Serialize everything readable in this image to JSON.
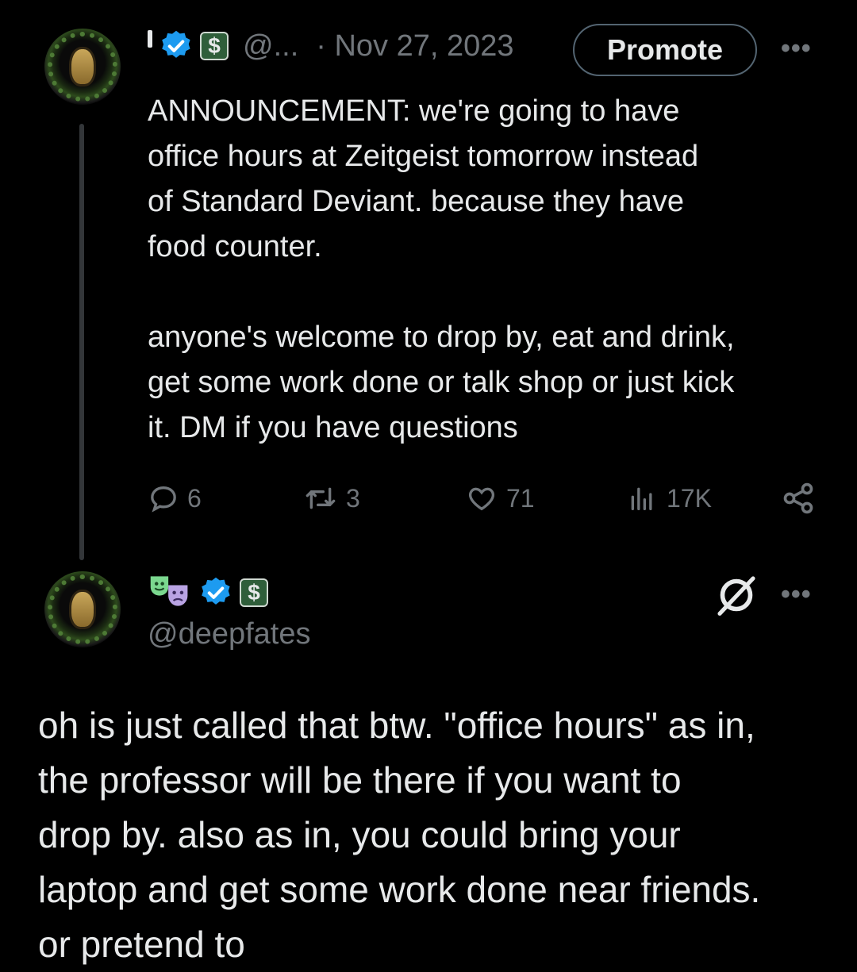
{
  "tweet": {
    "handle": "@...",
    "date": "· Nov 27, 2023",
    "promote_label": "Promote",
    "more_label": "•••",
    "text": "ANNOUNCEMENT: we're going to have\noffice hours at Zeitgeist tomorrow instead\nof Standard Deviant. because they have\nfood counter.\n\nanyone's welcome to drop by, eat and drink,\nget some work done or talk shop or just kick\nit. DM if you have questions",
    "stats": {
      "replies": "6",
      "reposts": "3",
      "likes": "71",
      "views": "17K"
    }
  },
  "reply": {
    "handle": "@deepfates",
    "more_label": "•••",
    "text": "oh is just called that btw. \"office hours\" as in,\nthe professor will be there if you want to\ndrop by. also as in, you could bring your\nlaptop and get some work done near friends.\nor pretend to"
  },
  "icons": {
    "verified": "verified-badge-icon",
    "s_badge": "s-badge-icon",
    "masks": "theater-masks-icon",
    "grok": "grok-icon"
  },
  "colors": {
    "background": "#000000",
    "text": "#e7e9ea",
    "muted": "#71767b",
    "verified_blue": "#1d9bf0"
  }
}
